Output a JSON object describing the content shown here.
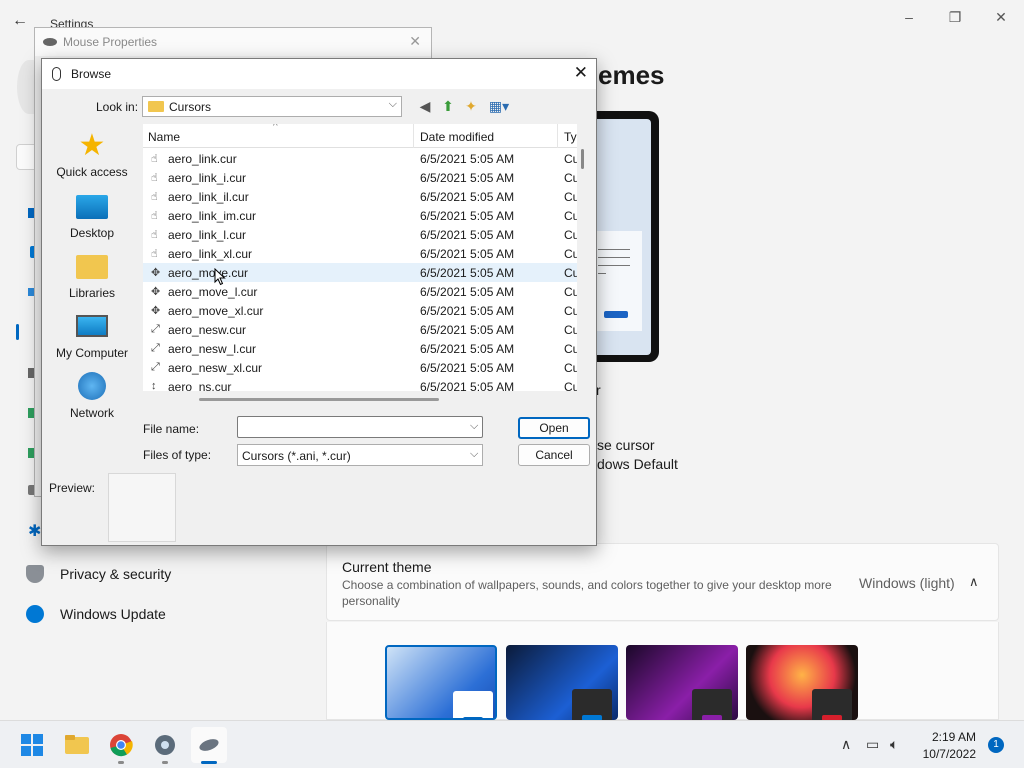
{
  "settings": {
    "title": "Settings",
    "heading": "emes",
    "cursor_line_1": "se cursor",
    "cursor_line_2": "dows Default",
    "r_letter": "r",
    "nav": [
      {
        "label": "Privacy & security",
        "icon": "shield-icon"
      },
      {
        "label": "Windows Update",
        "icon": "refresh-icon"
      }
    ],
    "current_theme": {
      "title": "Current theme",
      "description": "Choose a combination of wallpapers, sounds, and colors together to give your desktop more personality",
      "value": "Windows (light)"
    },
    "theme_thumbs": [
      "windows-light",
      "windows-dark",
      "glow",
      "captured-motion"
    ]
  },
  "mouse_properties": {
    "title": "Mouse Properties"
  },
  "browse": {
    "title": "Browse",
    "look_in_label": "Look in:",
    "look_in_value": "Cursors",
    "places": [
      "Quick access",
      "Desktop",
      "Libraries",
      "My Computer",
      "Network"
    ],
    "columns": {
      "name": "Name",
      "date": "Date modified",
      "type": "Ty"
    },
    "files": [
      {
        "name": "aero_link.cur",
        "date": "6/5/2021 5:05 AM",
        "type": "Cu",
        "icon": "hand-icon"
      },
      {
        "name": "aero_link_i.cur",
        "date": "6/5/2021 5:05 AM",
        "type": "Cu",
        "icon": "hand-icon"
      },
      {
        "name": "aero_link_il.cur",
        "date": "6/5/2021 5:05 AM",
        "type": "Cu",
        "icon": "hand-icon"
      },
      {
        "name": "aero_link_im.cur",
        "date": "6/5/2021 5:05 AM",
        "type": "Cu",
        "icon": "hand-icon"
      },
      {
        "name": "aero_link_l.cur",
        "date": "6/5/2021 5:05 AM",
        "type": "Cu",
        "icon": "hand-icon"
      },
      {
        "name": "aero_link_xl.cur",
        "date": "6/5/2021 5:05 AM",
        "type": "Cu",
        "icon": "hand-icon"
      },
      {
        "name": "aero_move.cur",
        "date": "6/5/2021 5:05 AM",
        "type": "Cu",
        "icon": "move-icon",
        "selected": true
      },
      {
        "name": "aero_move_l.cur",
        "date": "6/5/2021 5:05 AM",
        "type": "Cu",
        "icon": "move-icon"
      },
      {
        "name": "aero_move_xl.cur",
        "date": "6/5/2021 5:05 AM",
        "type": "Cu",
        "icon": "move-icon"
      },
      {
        "name": "aero_nesw.cur",
        "date": "6/5/2021 5:05 AM",
        "type": "Cu",
        "icon": "resize-diagonal-icon"
      },
      {
        "name": "aero_nesw_l.cur",
        "date": "6/5/2021 5:05 AM",
        "type": "Cu",
        "icon": "resize-diagonal-icon"
      },
      {
        "name": "aero_nesw_xl.cur",
        "date": "6/5/2021 5:05 AM",
        "type": "Cu",
        "icon": "resize-diagonal-icon"
      },
      {
        "name": "aero_ns.cur",
        "date": "6/5/2021 5:05 AM",
        "type": "Cu",
        "icon": "resize-vertical-icon"
      }
    ],
    "file_name_label": "File name:",
    "file_name_value": "",
    "files_of_type_label": "Files of type:",
    "files_of_type_value": "Cursors (*.ani, *.cur)",
    "open_label": "Open",
    "cancel_label": "Cancel",
    "preview_label": "Preview:"
  },
  "taskbar": {
    "apps": [
      "start-icon",
      "file-explorer-icon",
      "chrome-icon",
      "settings-icon",
      "mouse-icon"
    ],
    "time": "2:19 AM",
    "date": "10/7/2022",
    "notifications": "1"
  },
  "colors": {
    "accent": "#0067c0",
    "selection": "#e5f1fb",
    "folder": "#f1c64f"
  }
}
